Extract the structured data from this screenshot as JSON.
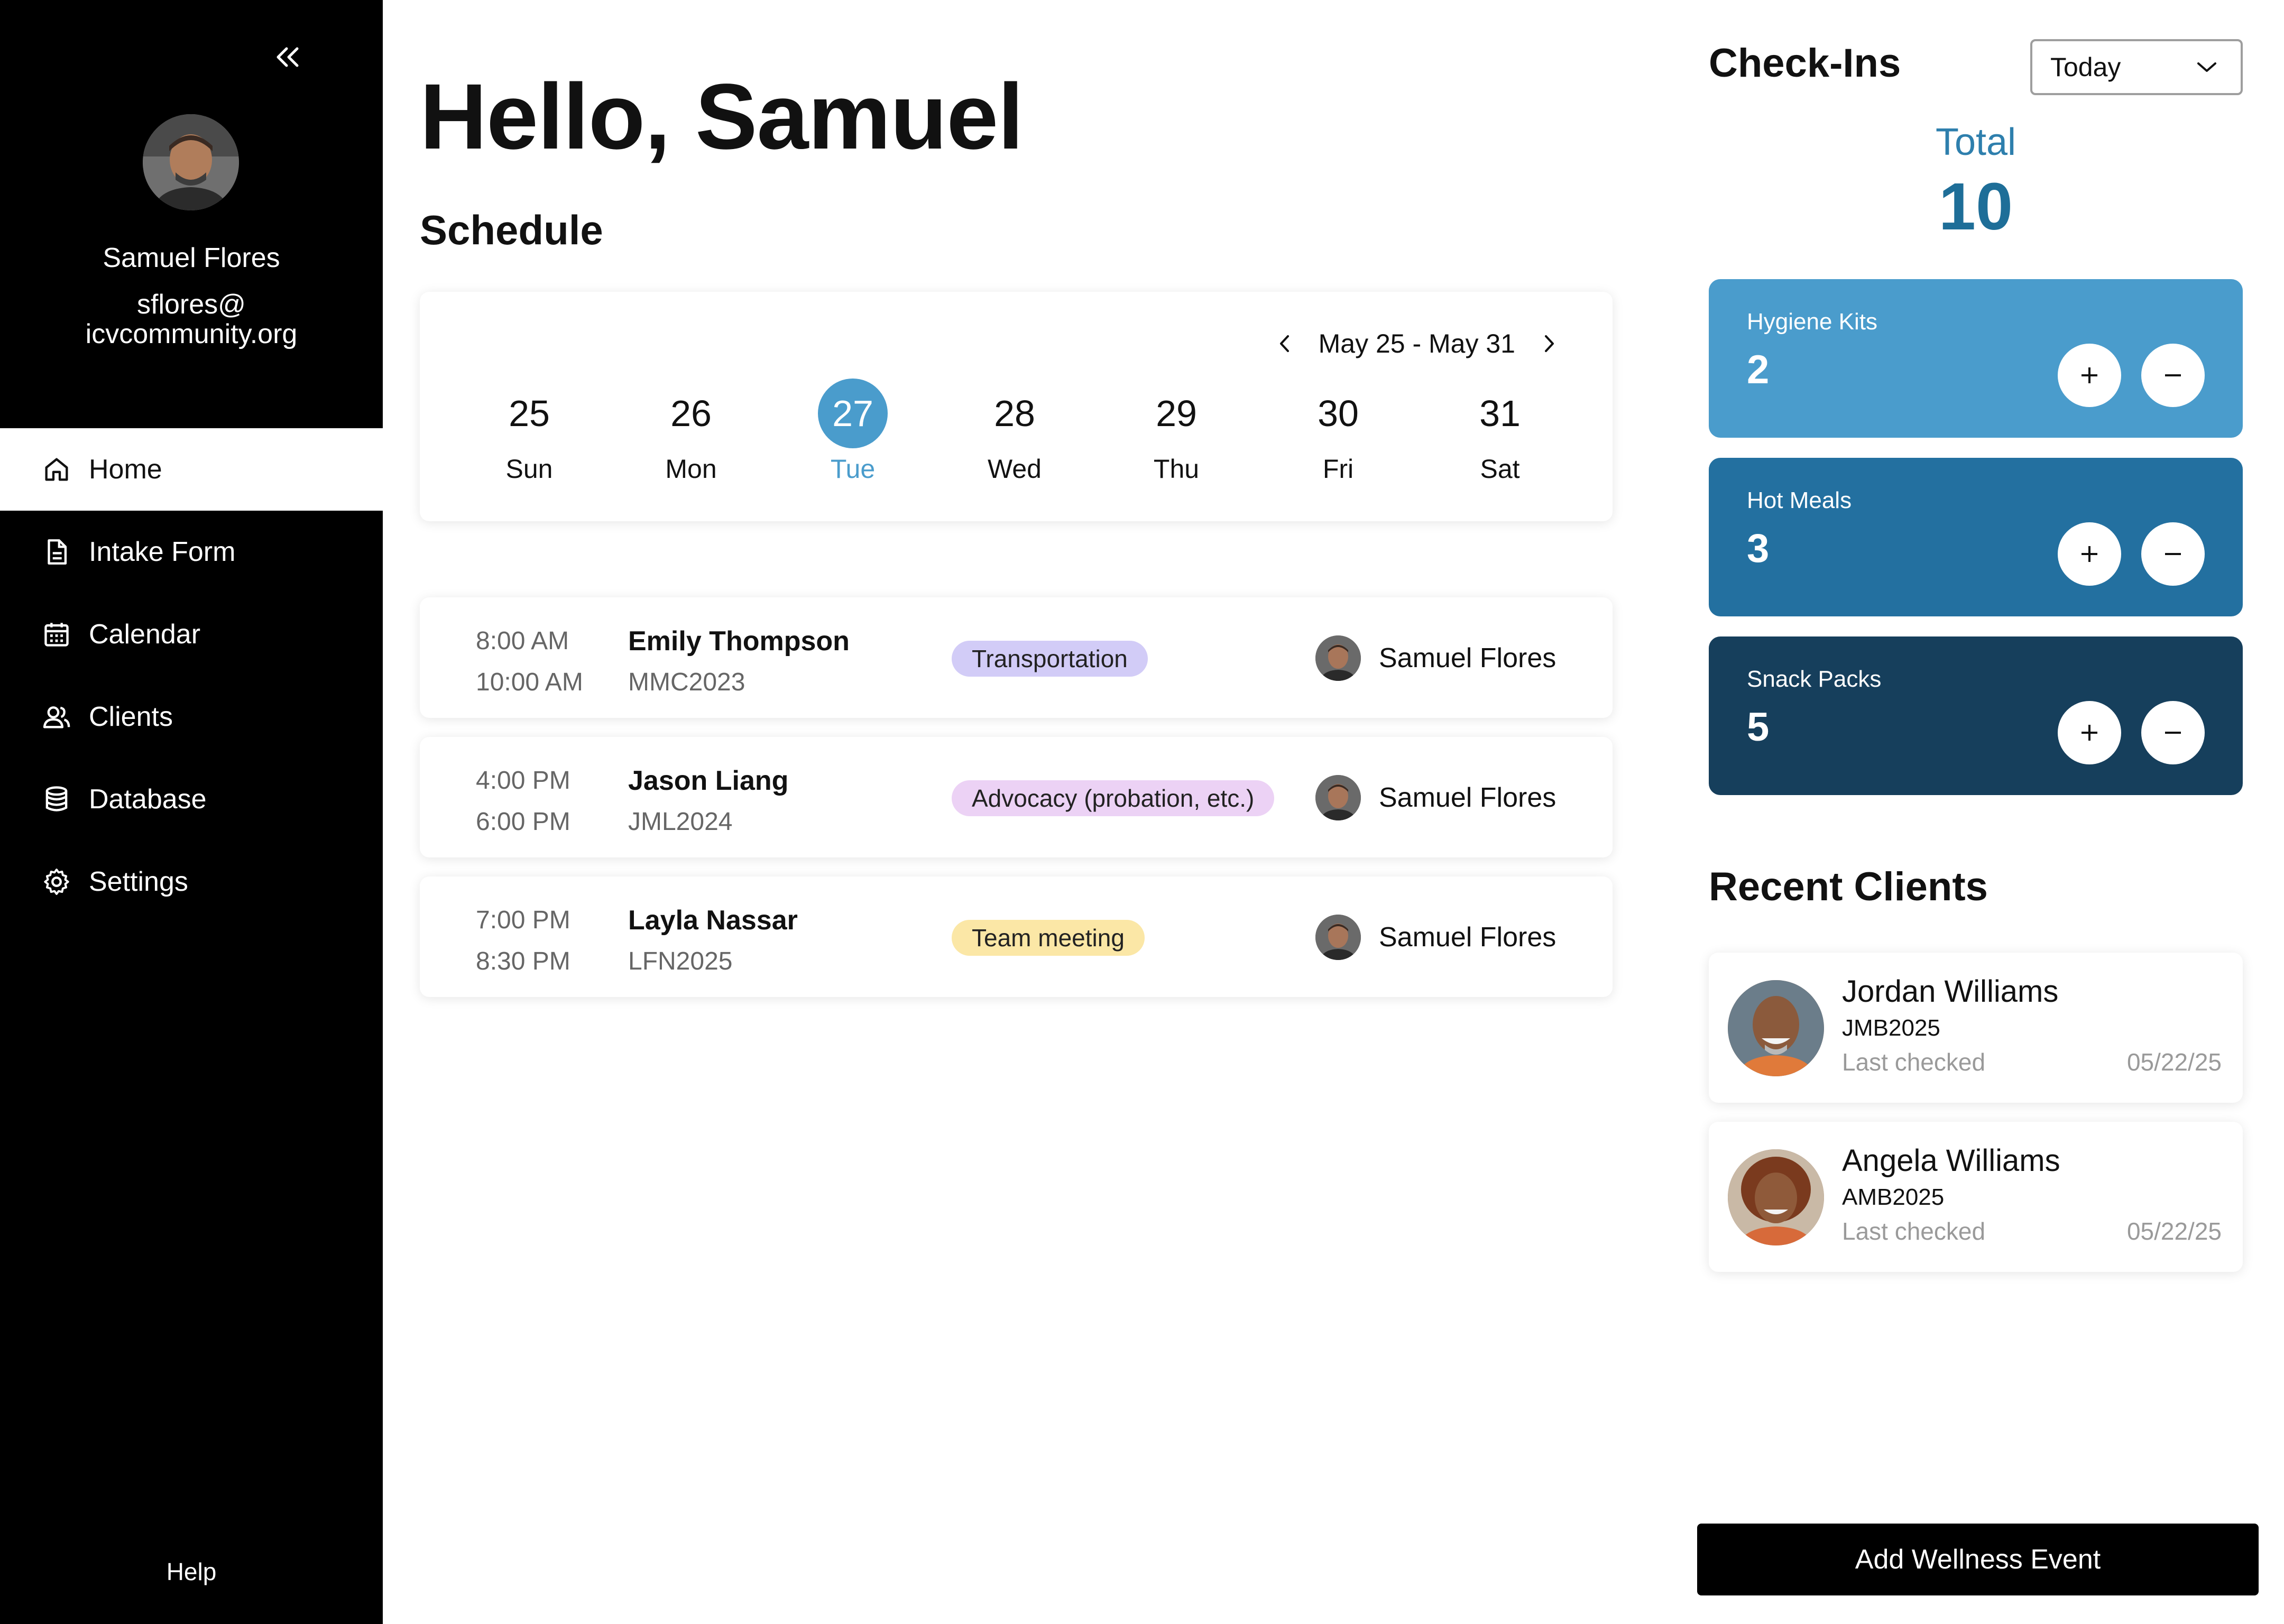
{
  "sidebar": {
    "user": {
      "name": "Samuel Flores",
      "email_line1": "sflores@",
      "email_line2": "icvcommunity.org"
    },
    "nav": [
      {
        "label": "Home",
        "icon": "home-icon",
        "active": true
      },
      {
        "label": "Intake Form",
        "icon": "document-icon"
      },
      {
        "label": "Calendar",
        "icon": "calendar-icon"
      },
      {
        "label": "Clients",
        "icon": "users-icon"
      },
      {
        "label": "Database",
        "icon": "database-icon"
      },
      {
        "label": "Settings",
        "icon": "gear-icon"
      }
    ],
    "help": "Help",
    "collapse_icon": "double-chevron-left-icon"
  },
  "main": {
    "greeting": "Hello, Samuel",
    "schedule_title": "Schedule",
    "week": {
      "range": "May 25 - May 31",
      "days": [
        {
          "num": "25",
          "name": "Sun"
        },
        {
          "num": "26",
          "name": "Mon"
        },
        {
          "num": "27",
          "name": "Tue",
          "selected": true
        },
        {
          "num": "28",
          "name": "Wed"
        },
        {
          "num": "29",
          "name": "Thu"
        },
        {
          "num": "30",
          "name": "Fri"
        },
        {
          "num": "31",
          "name": "Sat"
        }
      ]
    },
    "appointments": [
      {
        "start": "8:00 AM",
        "end": "10:00 AM",
        "client": "Emily Thompson",
        "client_id": "MMC2023",
        "tag": "Transportation",
        "tag_color": "#d2ccf7",
        "staff": "Samuel Flores"
      },
      {
        "start": "4:00 PM",
        "end": "6:00 PM",
        "client": "Jason Liang",
        "client_id": "JML2024",
        "tag": "Advocacy (probation, etc.)",
        "tag_color": "#ecd2f5",
        "staff": "Samuel Flores"
      },
      {
        "start": "7:00 PM",
        "end": "8:30 PM",
        "client": "Layla Nassar",
        "client_id": "LFN2025",
        "tag": "Team meeting",
        "tag_color": "#fbe7a6",
        "staff": "Samuel Flores"
      }
    ]
  },
  "checkins": {
    "title": "Check-Ins",
    "range": "Today",
    "total_label": "Total",
    "total_value": "10",
    "counters": [
      {
        "label": "Hygiene Kits",
        "value": "2",
        "color": "#4a9ccc"
      },
      {
        "label": "Hot Meals",
        "value": "3",
        "color": "#2370a0"
      },
      {
        "label": "Snack Packs",
        "value": "5",
        "color": "#163f5c"
      }
    ]
  },
  "recent": {
    "title": "Recent Clients",
    "clients": [
      {
        "name": "Jordan Williams",
        "id": "JMB2025",
        "last_label": "Last checked",
        "date": "05/22/25"
      },
      {
        "name": "Angela Williams",
        "id": "AMB2025",
        "last_label": "Last checked",
        "date": "05/22/25"
      }
    ]
  },
  "cta": {
    "label": "Add Wellness Event"
  },
  "colors": {
    "accent": "#4a9ccc",
    "total_text": "#1e6e98",
    "sidebar_bg": "#000000"
  }
}
